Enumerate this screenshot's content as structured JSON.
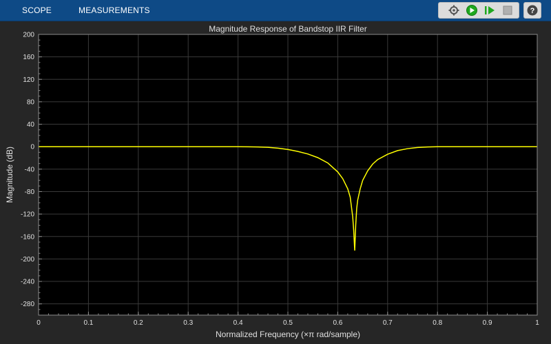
{
  "toolstrip": {
    "tabs": [
      {
        "label": "SCOPE"
      },
      {
        "label": "MEASUREMENTS"
      }
    ],
    "buttons": [
      {
        "icon": "settings-gear-icon"
      },
      {
        "icon": "run-icon"
      },
      {
        "icon": "step-forward-icon"
      },
      {
        "icon": "stop-icon"
      },
      {
        "icon": "help-icon",
        "label": "?"
      }
    ],
    "colors": {
      "bar": "#0e4a86",
      "run_green": "#1fa81f",
      "stop_gray": "#b0b0b0"
    }
  },
  "plot": {
    "background": "#000000",
    "line_color": "#ffff00",
    "grid_color": "#3a3a3a"
  },
  "chart_data": {
    "type": "line",
    "title": "Magnitude Response of Bandstop IIR Filter",
    "xlabel": "Normalized Frequency (×π rad/sample)",
    "ylabel": "Magnitude (dB)",
    "xlim": [
      0,
      1
    ],
    "ylim": [
      -300,
      200
    ],
    "xticks": [
      "0",
      "0.1",
      "0.2",
      "0.3",
      "0.4",
      "0.5",
      "0.6",
      "0.7",
      "0.8",
      "0.9",
      "1"
    ],
    "yticks": [
      "200",
      "160",
      "120",
      "80",
      "40",
      "0",
      "-40",
      "-80",
      "-120",
      "-160",
      "-200",
      "-240",
      "-280"
    ],
    "grid": true,
    "series": [
      {
        "x": [
          0,
          0.1,
          0.2,
          0.3,
          0.4,
          0.42,
          0.44,
          0.46,
          0.48,
          0.5,
          0.52,
          0.54,
          0.56,
          0.58,
          0.6,
          0.61,
          0.62,
          0.625,
          0.63,
          0.632,
          0.634,
          0.636,
          0.638,
          0.64,
          0.645,
          0.65,
          0.66,
          0.67,
          0.68,
          0.7,
          0.72,
          0.74,
          0.76,
          0.78,
          0.8,
          0.85,
          0.9,
          1
        ],
        "y": [
          0,
          0,
          0,
          0,
          0,
          -0.2,
          -0.5,
          -1.2,
          -2.7,
          -5,
          -8.5,
          -13,
          -19.5,
          -29,
          -45,
          -57,
          -75,
          -90,
          -125,
          -150,
          -185,
          -140,
          -110,
          -95,
          -75,
          -60,
          -43,
          -31,
          -23,
          -13.5,
          -7,
          -3.5,
          -1.5,
          -0.5,
          -0.1,
          0,
          0,
          0
        ]
      }
    ]
  }
}
